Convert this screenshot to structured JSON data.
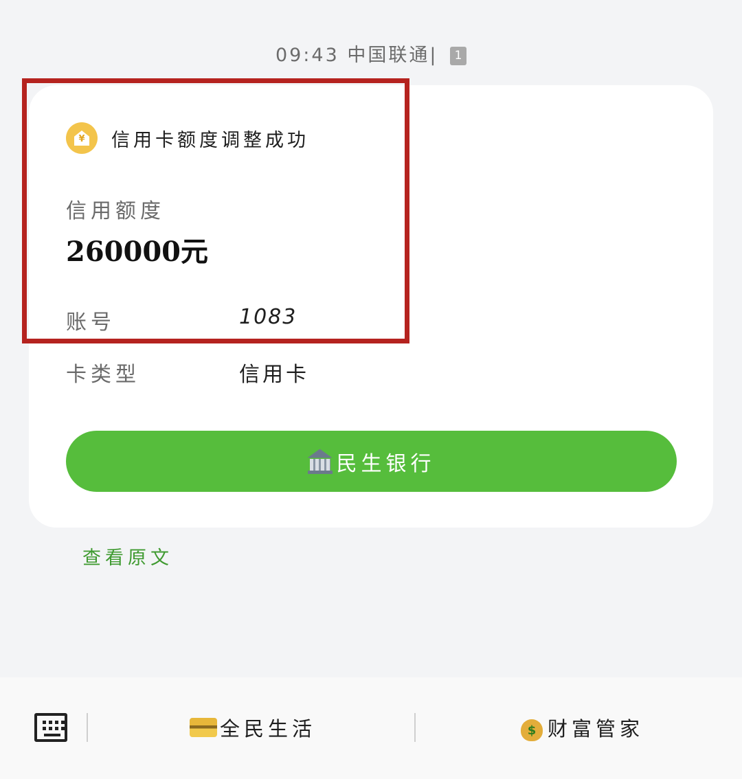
{
  "status_bar": {
    "time": "09:43",
    "carrier": "中国联通",
    "separator": "|",
    "sim_badge": "1"
  },
  "notification": {
    "icon": "bank-notice-icon",
    "title": "信用卡额度调整成功"
  },
  "credit_limit": {
    "label": "信用额度",
    "value": "260000元"
  },
  "details": {
    "account_label": "账号",
    "account_value": "1083",
    "card_type_label": "卡类型",
    "card_type_value": "信用卡"
  },
  "bank_button": {
    "icon": "bank-building-icon",
    "label": "民生银行",
    "color": "#56bd3c"
  },
  "view_original": "查看原文",
  "bottom_menu": {
    "keyboard_icon": "keyboard-icon",
    "items": [
      {
        "icon": "credit-card-icon",
        "label": "全民生活"
      },
      {
        "icon": "money-bag-icon",
        "label": "财富管家"
      }
    ]
  },
  "colors": {
    "highlight_border": "#b5231f",
    "link_green": "#3f9a30"
  }
}
